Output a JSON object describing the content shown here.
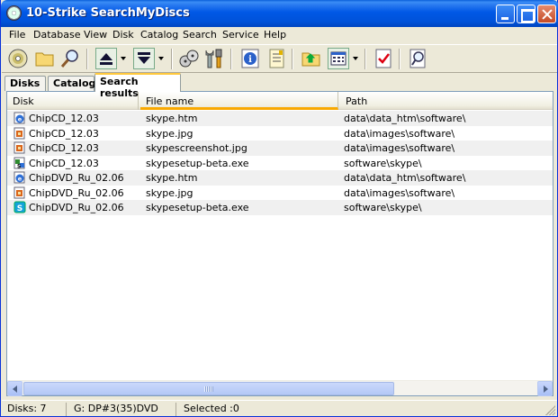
{
  "window": {
    "title": "10-Strike SearchMyDiscs"
  },
  "menu": [
    {
      "label": "File"
    },
    {
      "label": "Database"
    },
    {
      "label": "View"
    },
    {
      "label": "Disk"
    },
    {
      "label": "Catalog"
    },
    {
      "label": "Search"
    },
    {
      "label": "Service"
    },
    {
      "label": "Help"
    }
  ],
  "toolbar": {
    "icons": [
      "cd-add-icon",
      "open-folder-icon",
      "find-icon",
      "eject-icon",
      "load-icon",
      "scan-reels-icon",
      "tools-icon",
      "disk-info-icon",
      "catalog-report-icon",
      "up-folder-icon",
      "view-mode-icon",
      "check-list-icon",
      "search-doc-icon"
    ]
  },
  "tabs": [
    {
      "label": "Disks"
    },
    {
      "label": "Catalog"
    },
    {
      "label": "Search results"
    }
  ],
  "listview": {
    "columns": [
      "Disk",
      "File name",
      "Path"
    ],
    "rows": [
      {
        "disk": "ChipCD_12.03",
        "file": "skype.htm",
        "path": "data\\data_htm\\software\\",
        "icon": "html-file-icon"
      },
      {
        "disk": "ChipCD_12.03",
        "file": "skype.jpg",
        "path": "data\\images\\software\\",
        "icon": "image-file-icon"
      },
      {
        "disk": "ChipCD_12.03",
        "file": "skypescreenshot.jpg",
        "path": "data\\images\\software\\",
        "icon": "image-file-icon"
      },
      {
        "disk": "ChipCD_12.03",
        "file": "skypesetup-beta.exe",
        "path": "software\\skype\\",
        "icon": "setup-file-icon"
      },
      {
        "disk": "ChipDVD_Ru_02.06",
        "file": "skype.htm",
        "path": "data\\data_htm\\software\\",
        "icon": "html-file-icon"
      },
      {
        "disk": "ChipDVD_Ru_02.06",
        "file": "skype.jpg",
        "path": "data\\images\\software\\",
        "icon": "image-file-icon"
      },
      {
        "disk": "ChipDVD_Ru_02.06",
        "file": "skypesetup-beta.exe",
        "path": "software\\skype\\",
        "icon": "installer-file-icon"
      }
    ]
  },
  "status": {
    "disks": "Disks: 7",
    "drive": "G: DP#3(35)DVD",
    "selected": "Selected :0"
  }
}
